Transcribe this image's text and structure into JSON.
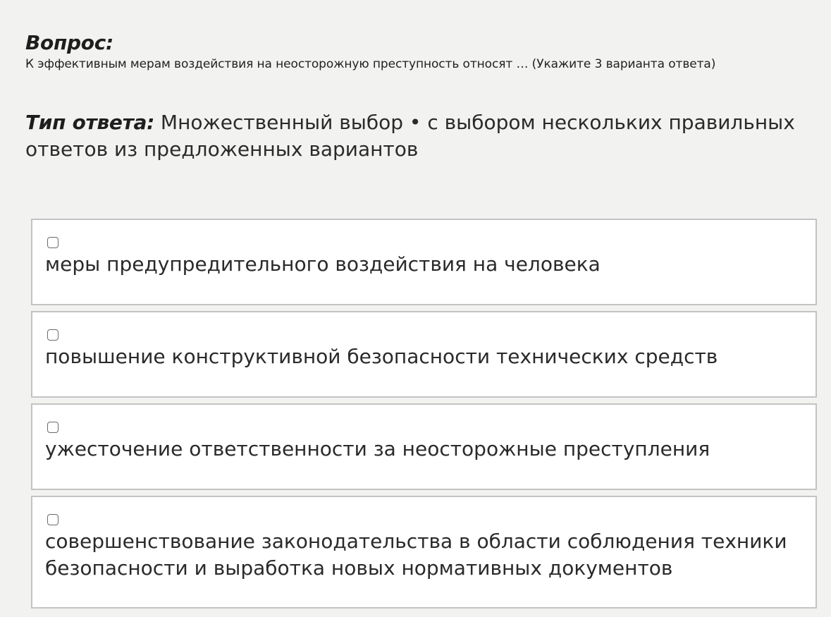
{
  "question": {
    "heading": "Вопрос:",
    "text": "К эффективным мерам воздействия на неосторожную преступность относят … (Укажите 3 варианта ответа)"
  },
  "answer_type": {
    "label": "Тип ответа:",
    "value": "Множественный выбор • с выбором нескольких правильных ответов из предложенных вариантов"
  },
  "options": [
    {
      "label": "меры предупредительного воздействия на человека",
      "checked": false
    },
    {
      "label": "повышение конструктивной безопасности технических средств",
      "checked": false
    },
    {
      "label": "ужесточение ответственности за неосторожные преступления",
      "checked": false
    },
    {
      "label": "совершенствование законодательства в области соблюдения техники безопасности и выработка новых нормативных документов",
      "checked": false
    }
  ]
}
